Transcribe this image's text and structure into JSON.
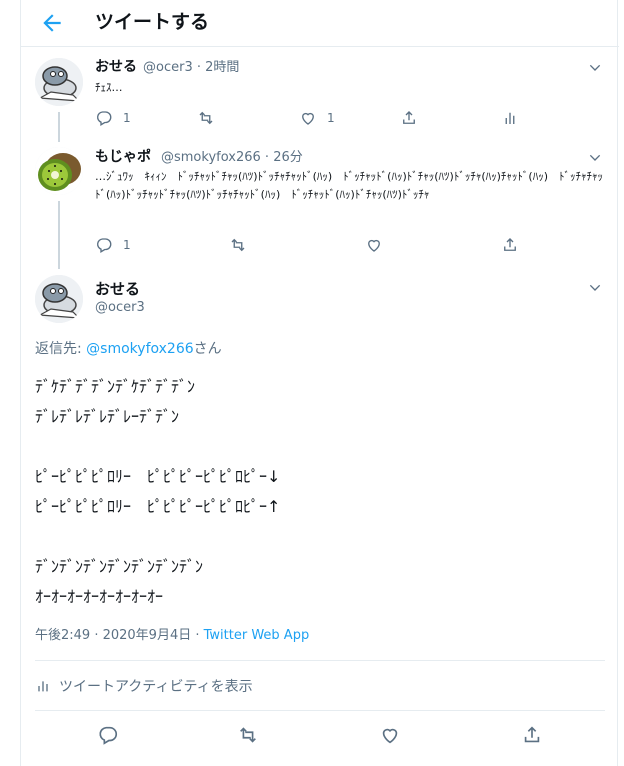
{
  "header": {
    "title": "ツイートする"
  },
  "tweets": [
    {
      "name": "おせる",
      "handle": "@ocer3",
      "time": "2時間",
      "text": "ﾁｪｽ…",
      "actions": {
        "reply_count": "1",
        "retweet_count": "",
        "like_count": "1"
      }
    },
    {
      "name": "もじゃポ",
      "handle": "@smokyfox266",
      "time": "26分",
      "text": "…ｼﾞｭﾜｯ　ｷｨｨﾝ　ﾄﾞｯﾁｬｯﾄﾞﾁｬｯ(ﾊﾂ)ﾄﾞｯﾁｬﾁｬｯﾄﾞ(ﾊｯ)　ﾄﾞｯﾁｬｯﾄﾞ(ﾊｯ)ﾄﾞﾁｬｯ(ﾊﾂ)ﾄﾞｯﾁｬ(ﾊｯ)ﾁｬｯﾄﾞ(ﾊｯ)　ﾄﾞｯﾁｬﾁｬｯﾄﾞ(ﾊｯ)ﾄﾞｯﾁｬｯﾄﾞﾁｬｯ(ﾊﾂ)ﾄﾞｯﾁｬﾁｬｯﾄﾞ(ﾊｯ)　ﾄﾞｯﾁｬｯﾄﾞ(ﾊｯ)ﾄﾞﾁｬｯ(ﾊﾂ)ﾄﾞｯﾁｬ",
      "actions": {
        "reply_count": "1",
        "retweet_count": "",
        "like_count": ""
      }
    }
  ],
  "main_tweet": {
    "name": "おせる",
    "handle": "@ocer3",
    "reply_to_label": "返信先: ",
    "reply_to_handle": "@smokyfox266",
    "reply_to_suffix": "さん",
    "lines": [
      "ﾃﾞｹﾃﾞﾃﾞﾃﾞﾝﾃﾞｹﾃﾞﾃﾞﾃﾞﾝ",
      "ﾃﾞﾚﾃﾞﾚﾃﾞﾚﾃﾞﾚｰﾃﾞﾃﾞﾝ",
      "",
      "ﾋﾟｰﾋﾟﾋﾟﾋﾟﾛﾘｰ　ﾋﾟﾋﾟﾋﾟｰﾋﾟﾋﾟﾛﾋﾟｰ↓",
      "ﾋﾟｰﾋﾟﾋﾟﾋﾟﾛﾘｰ　ﾋﾟﾋﾟﾋﾟｰﾋﾟﾋﾟﾛﾋﾟｰ↑",
      "",
      "ﾃﾞﾝﾃﾞﾝﾃﾞﾝﾃﾞﾝﾃﾞﾝﾃﾞﾝﾃﾞﾝ",
      "ｵｰｵｰｵｰｵｰｵｰｵｰｵｰｵｰ"
    ],
    "timestamp": "午後2:49 · 2020年9月4日 · ",
    "source": "Twitter Web App",
    "activity_label": "ツイートアクティビティを表示"
  },
  "colors": {
    "accent": "#1da1f2",
    "muted": "#5b7083",
    "border": "#e6ecf0"
  }
}
